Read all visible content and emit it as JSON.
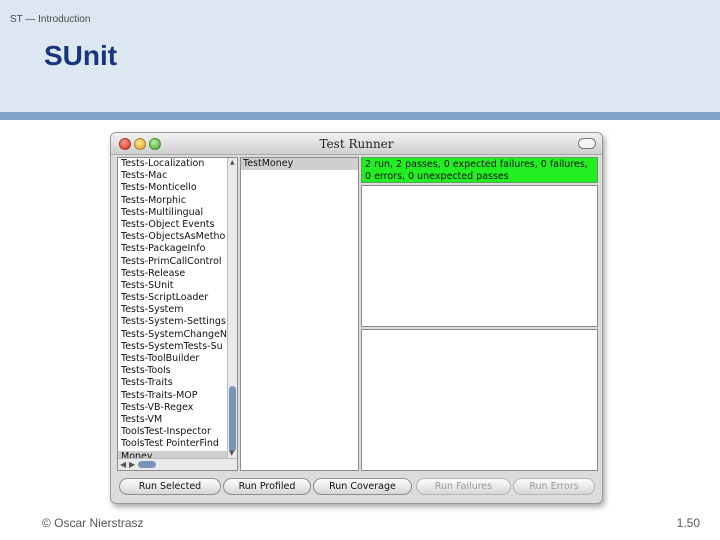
{
  "slide": {
    "breadcrumb": "ST — Introduction",
    "title": "SUnit",
    "footer_left": "© Oscar Nierstrasz",
    "page_number": "1.50"
  },
  "window": {
    "title": "Test Runner"
  },
  "categories": [
    "Tests-Localization",
    "Tests-Mac",
    "Tests-Monticello",
    "Tests-Morphic",
    "Tests-Multilingual",
    "Tests-Object Events",
    "Tests-ObjectsAsMetho",
    "Tests-PackageInfo",
    "Tests-PrimCallControl",
    "Tests-Release",
    "Tests-SUnit",
    "Tests-ScriptLoader",
    "Tests-System",
    "Tests-System-Settings",
    "Tests-SystemChangeN",
    "Tests-SystemTests-Su",
    "Tests-ToolBuilder",
    "Tests-Tools",
    "Tests-Traits",
    "Tests-Traits-MOP",
    "Tests-VB-Regex",
    "Tests-VM",
    "ToolsTest-Inspector",
    "ToolsTest PointerFind",
    "Money"
  ],
  "selected_category": "Money",
  "classes": [
    "TestMoney"
  ],
  "result": {
    "summary": "2 run, 2 passes, 0 expected failures, 0 failures, 0 errors, 0 unexpected passes",
    "status_color": "#22ee22"
  },
  "buttons": {
    "run_selected": "Run Selected",
    "run_profiled": "Run Profiled",
    "run_coverage": "Run Coverage",
    "run_failures": "Run Failures",
    "run_errors": "Run Errors"
  },
  "colors": {
    "header_band": "#dde7f2",
    "header_rule": "#7fa3c8",
    "title": "#17357a"
  }
}
